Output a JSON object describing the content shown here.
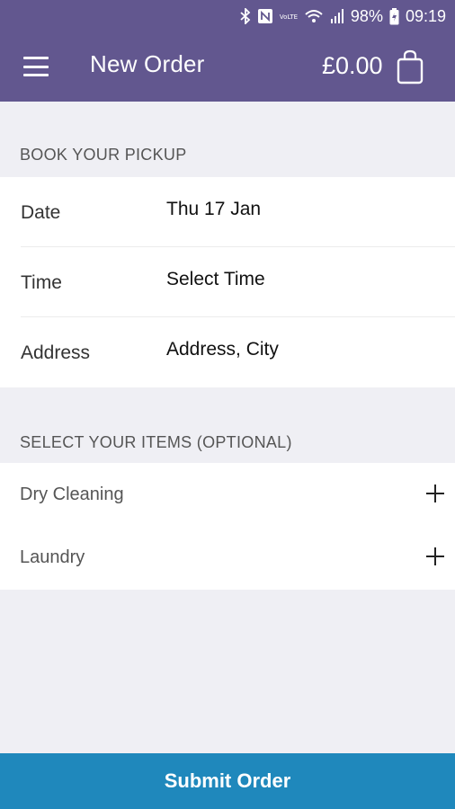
{
  "status_bar": {
    "battery_percent": "98%",
    "time": "09:19",
    "network_label": "VoLTE",
    "icons": [
      "bluetooth-icon",
      "nfc-icon",
      "volte-icon",
      "wifi-icon",
      "signal-icon",
      "battery-icon"
    ]
  },
  "app_bar": {
    "title": "New Order",
    "cart_total": "£0.00",
    "menu_icon": "hamburger-menu-icon",
    "cart_icon": "shopping-bag-icon",
    "background_color": "#62578f"
  },
  "pickup": {
    "heading": "BOOK YOUR PICKUP",
    "fields": [
      {
        "label": "Date",
        "value": "Thu 17 Jan"
      },
      {
        "label": "Time",
        "value": "Select Time"
      },
      {
        "label": "Address",
        "value": "Address, City"
      }
    ]
  },
  "items": {
    "heading": "SELECT YOUR ITEMS (OPTIONAL)",
    "list": [
      {
        "label": "Dry Cleaning",
        "icon": "plus-icon"
      },
      {
        "label": "Laundry",
        "icon": "plus-icon"
      }
    ]
  },
  "footer": {
    "submit_label": "Submit Order",
    "color": "#1f88bc"
  }
}
